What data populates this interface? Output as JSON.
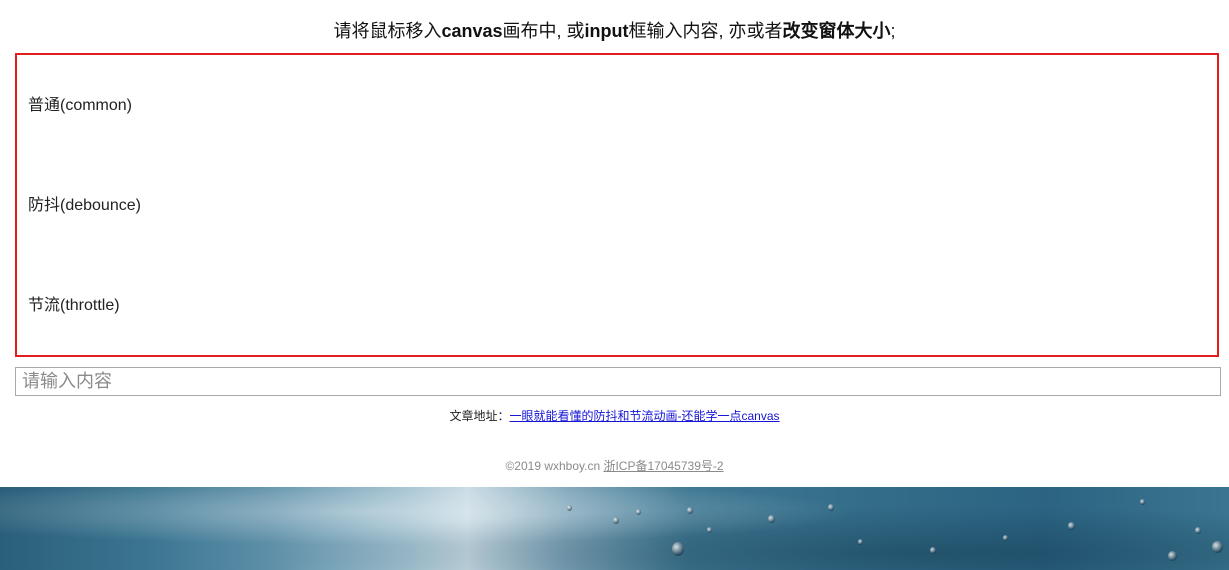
{
  "instruction": {
    "part1": "请将鼠标移入",
    "bold1": "canvas",
    "part2": "画布中, 或",
    "bold2": "input",
    "part3": "框输入内容, 亦或者",
    "bold3": "改变窗体大小",
    "part4": ";"
  },
  "canvas": {
    "rows": [
      {
        "label": "普通(common)"
      },
      {
        "label": "防抖(debounce)"
      },
      {
        "label": "节流(throttle)"
      }
    ],
    "border_color": "#e11d1d"
  },
  "input": {
    "placeholder": "请输入内容",
    "value": ""
  },
  "article": {
    "prefix": "文章地址：",
    "link_text": "一眼就能看懂的防抖和节流动画-还能学一点canvas"
  },
  "footer": {
    "copyright": "©2019 wxhboy.cn ",
    "icp_text": "浙ICP备17045739号-2"
  }
}
